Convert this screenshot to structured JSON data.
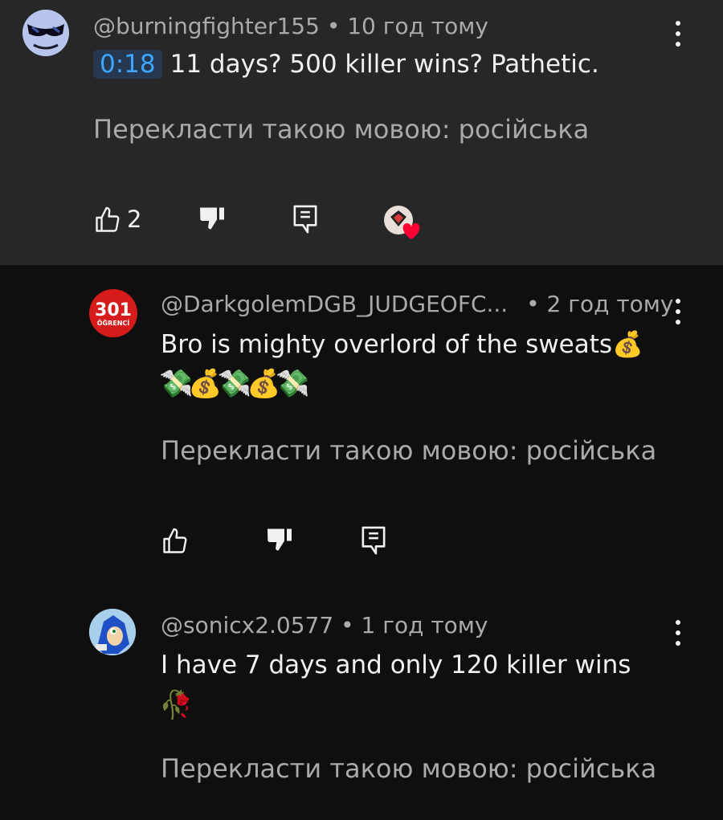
{
  "comments": [
    {
      "author": "@burningfighter155",
      "time": "10 год тому",
      "timestamp_link": "0:18",
      "text": "11 days? 500 killer wins? Pathetic.",
      "translate": "Перекласти такою мовою: російська",
      "likes": "2"
    },
    {
      "author": "@DarkgolemDGB_JUDGEOFC...",
      "time": "2 год тому",
      "text": "Bro is mighty overlord of the sweats💰",
      "text_line2": "💸💰💸💰💸",
      "translate": "Перекласти такою мовою: російська",
      "avatar_text_top": "301",
      "avatar_text_bottom": "ÖĞRENCİ"
    },
    {
      "author": "@sonicx2.0577",
      "time": "1 год тому",
      "text": "I have 7 days and only 120 killer wins",
      "text_line2": "🥀",
      "translate": "Перекласти такою мовою: російська"
    }
  ],
  "separator": "•",
  "colors": {
    "highlight_bg": "#272727",
    "page_bg": "#0f0f0f",
    "link_blue": "#3ea6ff",
    "secondary_text": "#aaaaaa",
    "heart_red": "#ff0033"
  }
}
